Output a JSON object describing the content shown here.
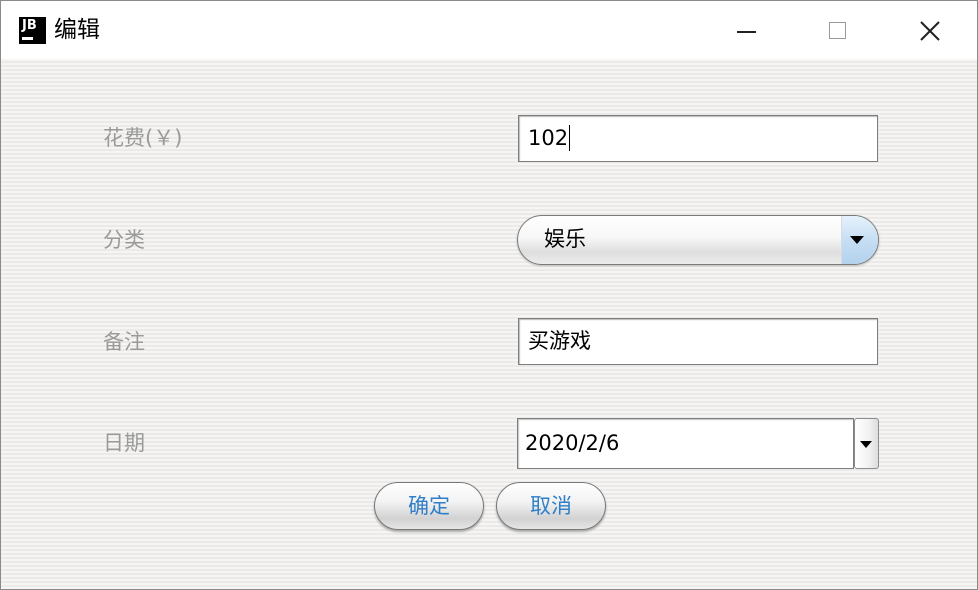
{
  "window": {
    "title": "编辑",
    "app_icon_text": "JB"
  },
  "form": {
    "cost": {
      "label": "花费(￥)",
      "value": "102"
    },
    "category": {
      "label": "分类",
      "selected": "娱乐"
    },
    "note": {
      "label": "备注",
      "value": "买游戏"
    },
    "date": {
      "label": "日期",
      "value": "2020/2/6"
    }
  },
  "buttons": {
    "ok_label": "确定",
    "cancel_label": "取消"
  },
  "colors": {
    "button_text": "#2f7fc8",
    "label_text": "#9a9a9a",
    "combo_arrow_accent": "#c6def3"
  },
  "icons": {
    "app": "jetbrains-logo-icon",
    "minimize": "minimize-icon",
    "maximize": "maximize-icon",
    "close": "close-icon",
    "dropdown": "chevron-down-icon"
  }
}
